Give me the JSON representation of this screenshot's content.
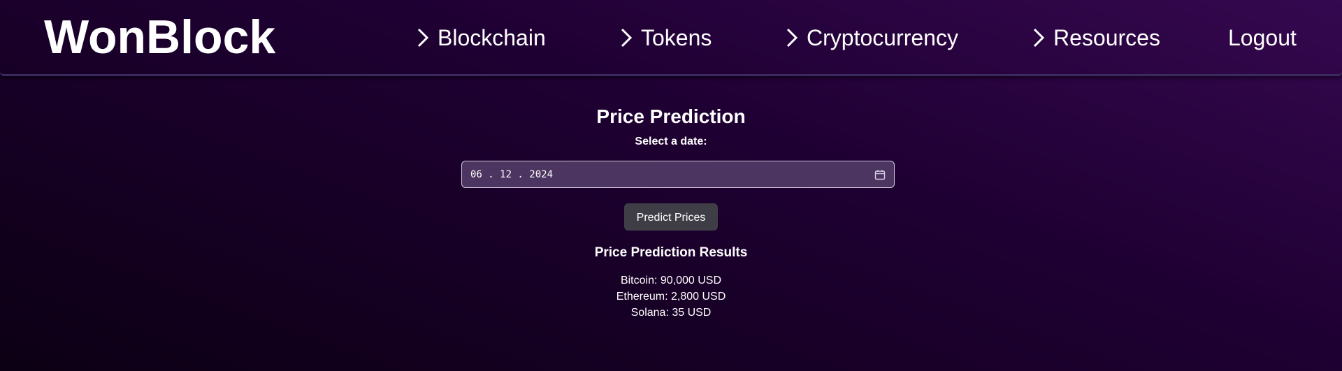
{
  "brand": "WonBlock",
  "nav": {
    "items": [
      {
        "label": "Blockchain",
        "icon": "chevron-right-icon"
      },
      {
        "label": "Tokens",
        "icon": "chevron-right-icon"
      },
      {
        "label": "Cryptocurrency",
        "icon": "chevron-right-icon"
      },
      {
        "label": "Resources",
        "icon": "chevron-right-icon"
      }
    ],
    "logout": "Logout"
  },
  "prediction": {
    "title": "Price Prediction",
    "date_label": "Select a date:",
    "date_value": "06 . 12 . 2024",
    "date_icon": "calendar-icon",
    "button_label": "Predict Prices"
  },
  "results": {
    "title": "Price Prediction Results",
    "items": [
      "Bitcoin: 90,000 USD",
      "Ethereum: 2,800 USD",
      "Solana: 35 USD"
    ]
  },
  "colors": {
    "background_start": "#35084f",
    "background_end": "#0c0014",
    "input_bg": "#4c3560",
    "button_bg": "#3f3e47"
  }
}
